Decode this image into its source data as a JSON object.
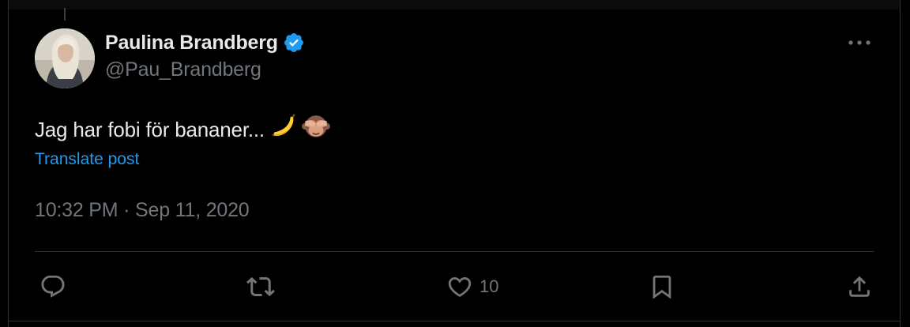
{
  "tweet": {
    "author": {
      "display_name": "Paulina Brandberg",
      "handle": "@Pau_Brandberg",
      "verified": true
    },
    "text": "Jag har fobi för bananer...",
    "emojis": [
      "banana-emoji",
      "see-no-evil-monkey-emoji"
    ],
    "translate_label": "Translate post",
    "timestamp": "10:32 PM · Sep 11, 2020"
  },
  "actions": {
    "reply": {
      "icon": "reply-icon"
    },
    "retweet": {
      "icon": "retweet-icon"
    },
    "like": {
      "icon": "heart-icon",
      "count": "10"
    },
    "bookmark": {
      "icon": "bookmark-icon"
    },
    "share": {
      "icon": "share-icon"
    }
  },
  "colors": {
    "background": "#000000",
    "text_primary": "#e7e9ea",
    "text_secondary": "#71767b",
    "link": "#1d9bf0",
    "verified": "#1d9bf0",
    "divider": "#2f3336"
  }
}
